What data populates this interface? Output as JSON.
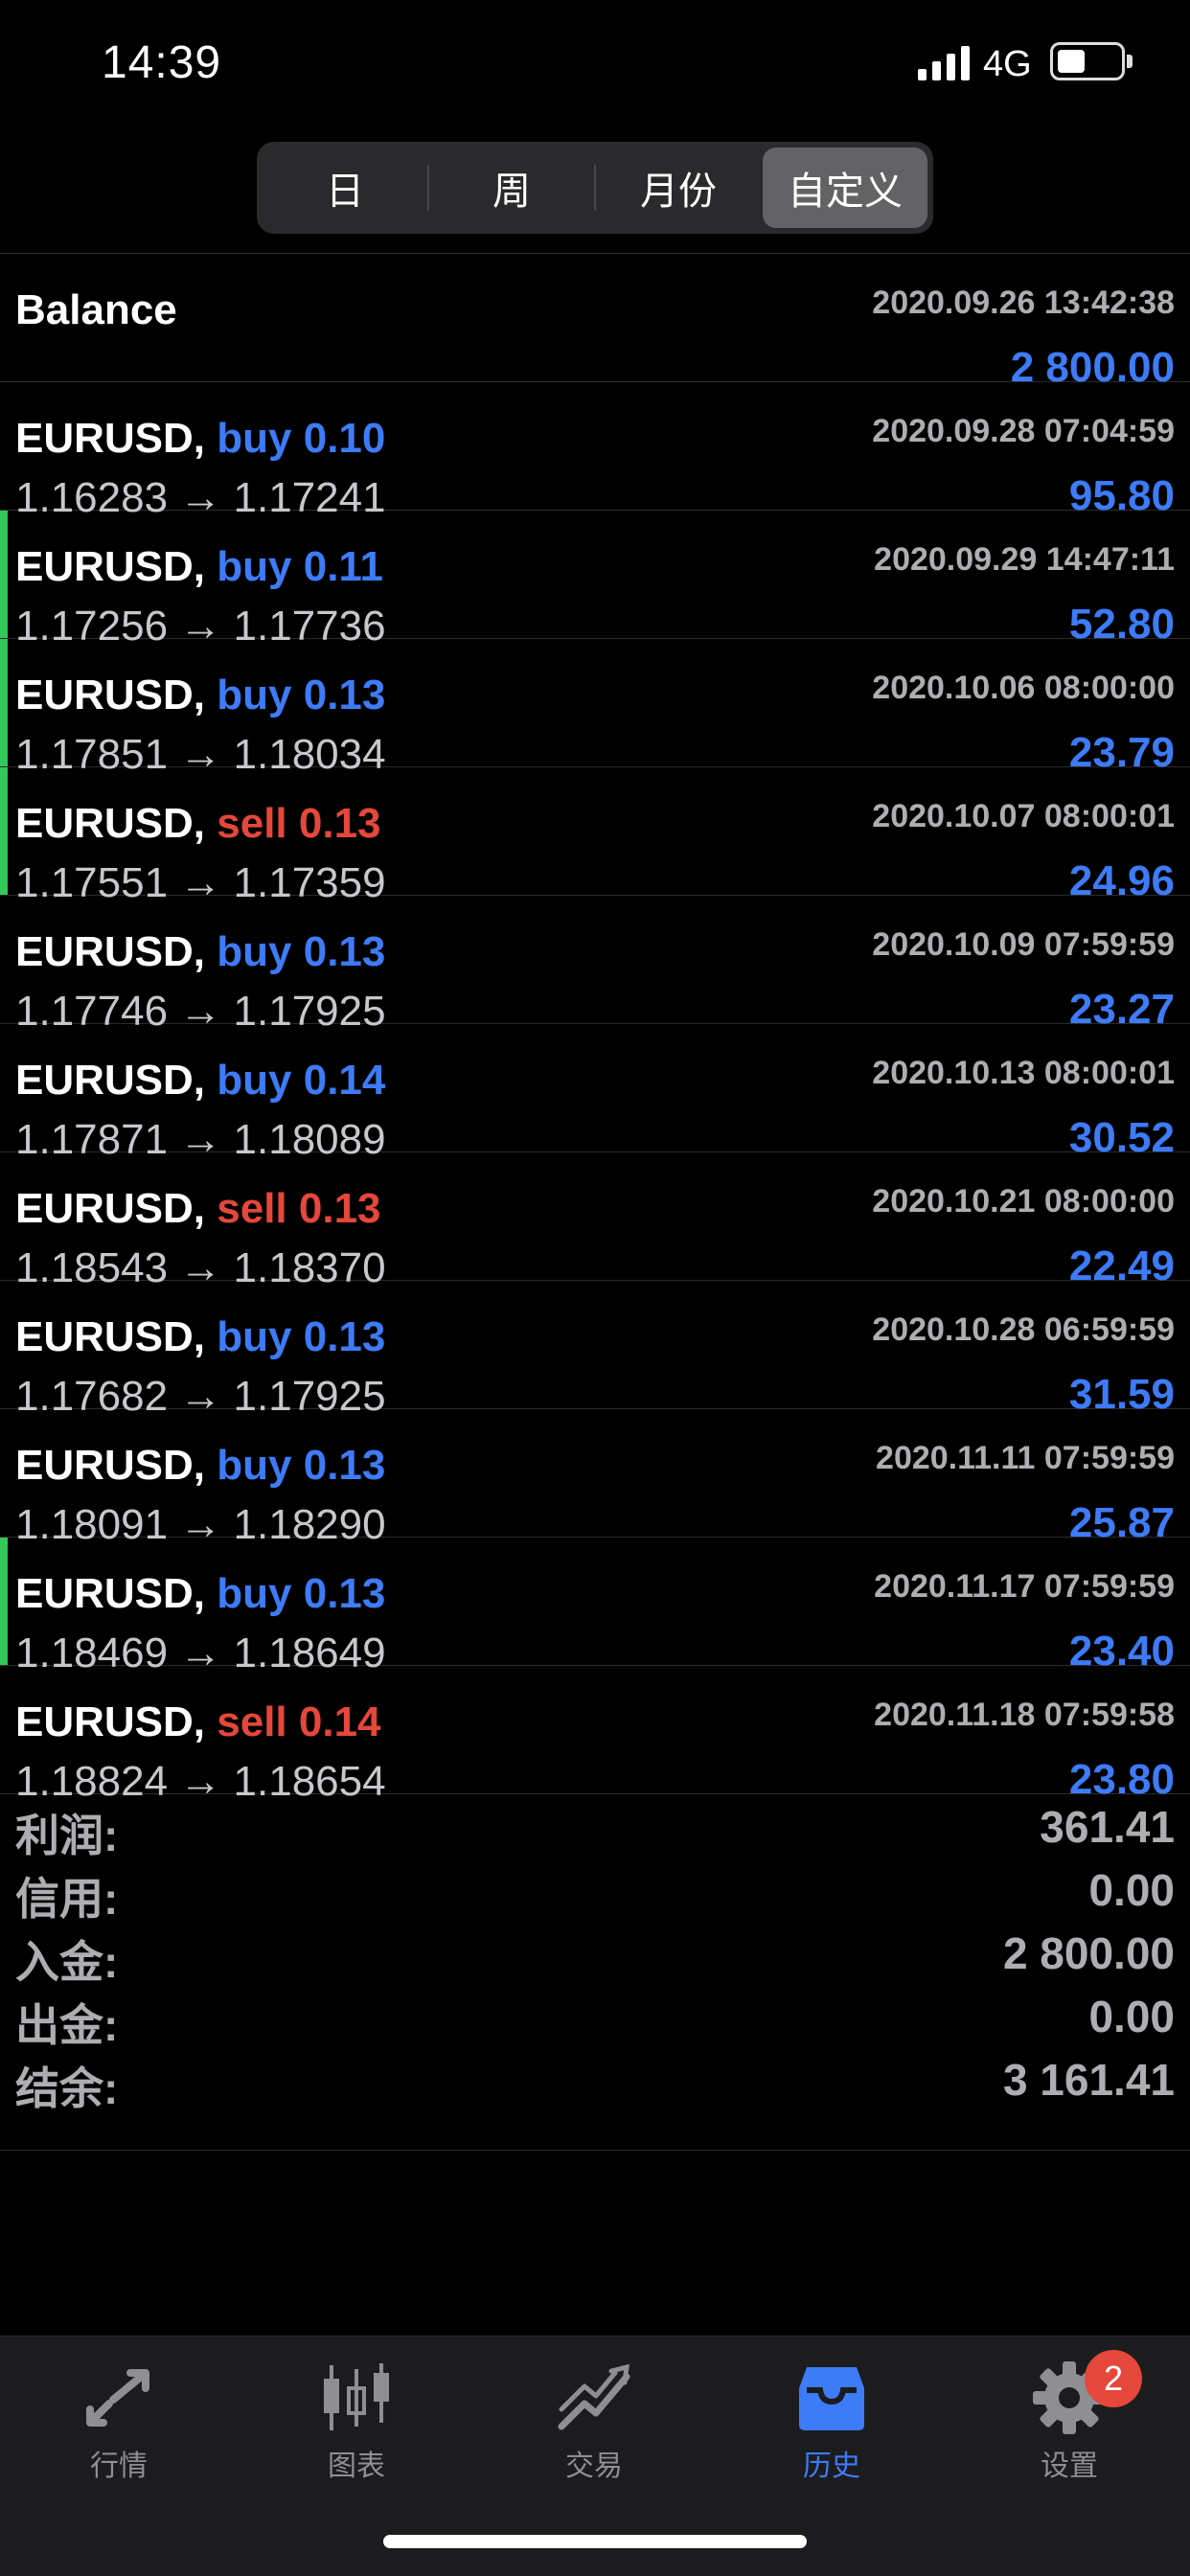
{
  "status": {
    "time": "14:39",
    "network": "4G"
  },
  "segments": [
    {
      "label": "日",
      "active": false
    },
    {
      "label": "周",
      "active": false
    },
    {
      "label": "月份",
      "active": false
    },
    {
      "label": "自定义",
      "active": true
    }
  ],
  "balance": {
    "title": "Balance",
    "date": "2020.09.26 13:42:38",
    "amount": "2 800.00"
  },
  "deals": [
    {
      "symbol": "EURUSD,",
      "side": "buy",
      "volume": "0.10",
      "open": "1.16283",
      "close": "1.17241",
      "date": "2020.09.28 07:04:59",
      "profit": "95.80",
      "marker": false
    },
    {
      "symbol": "EURUSD,",
      "side": "buy",
      "volume": "0.11",
      "open": "1.17256",
      "close": "1.17736",
      "date": "2020.09.29 14:47:11",
      "profit": "52.80",
      "marker": true
    },
    {
      "symbol": "EURUSD,",
      "side": "buy",
      "volume": "0.13",
      "open": "1.17851",
      "close": "1.18034",
      "date": "2020.10.06 08:00:00",
      "profit": "23.79",
      "marker": true
    },
    {
      "symbol": "EURUSD,",
      "side": "sell",
      "volume": "0.13",
      "open": "1.17551",
      "close": "1.17359",
      "date": "2020.10.07 08:00:01",
      "profit": "24.96",
      "marker": true
    },
    {
      "symbol": "EURUSD,",
      "side": "buy",
      "volume": "0.13",
      "open": "1.17746",
      "close": "1.17925",
      "date": "2020.10.09 07:59:59",
      "profit": "23.27",
      "marker": false
    },
    {
      "symbol": "EURUSD,",
      "side": "buy",
      "volume": "0.14",
      "open": "1.17871",
      "close": "1.18089",
      "date": "2020.10.13 08:00:01",
      "profit": "30.52",
      "marker": false
    },
    {
      "symbol": "EURUSD,",
      "side": "sell",
      "volume": "0.13",
      "open": "1.18543",
      "close": "1.18370",
      "date": "2020.10.21 08:00:00",
      "profit": "22.49",
      "marker": false
    },
    {
      "symbol": "EURUSD,",
      "side": "buy",
      "volume": "0.13",
      "open": "1.17682",
      "close": "1.17925",
      "date": "2020.10.28 06:59:59",
      "profit": "31.59",
      "marker": false
    },
    {
      "symbol": "EURUSD,",
      "side": "buy",
      "volume": "0.13",
      "open": "1.18091",
      "close": "1.18290",
      "date": "2020.11.11 07:59:59",
      "profit": "25.87",
      "marker": false
    },
    {
      "symbol": "EURUSD,",
      "side": "buy",
      "volume": "0.13",
      "open": "1.18469",
      "close": "1.18649",
      "date": "2020.11.17 07:59:59",
      "profit": "23.40",
      "marker": true
    },
    {
      "symbol": "EURUSD,",
      "side": "sell",
      "volume": "0.14",
      "open": "1.18824",
      "close": "1.18654",
      "date": "2020.11.18 07:59:58",
      "profit": "23.80",
      "marker": false
    }
  ],
  "summary": [
    {
      "label": "利润:",
      "value": "361.41"
    },
    {
      "label": "信用:",
      "value": "0.00"
    },
    {
      "label": "入金:",
      "value": "2 800.00"
    },
    {
      "label": "出金:",
      "value": "0.00"
    },
    {
      "label": "结余:",
      "value": "3 161.41"
    }
  ],
  "tabs": [
    {
      "label": "行情",
      "icon": "quotes-arrows-icon",
      "active": false
    },
    {
      "label": "图表",
      "icon": "candlestick-chart-icon",
      "active": false
    },
    {
      "label": "交易",
      "icon": "trade-trend-icon",
      "active": false
    },
    {
      "label": "历史",
      "icon": "history-inbox-icon",
      "active": true
    },
    {
      "label": "设置",
      "icon": "gear-icon",
      "active": false,
      "badge": "2"
    }
  ],
  "colors": {
    "buy": "#3d7bf7",
    "sell": "#e5473a",
    "marker": "#34c759",
    "active_tab": "#3d7bf7"
  }
}
